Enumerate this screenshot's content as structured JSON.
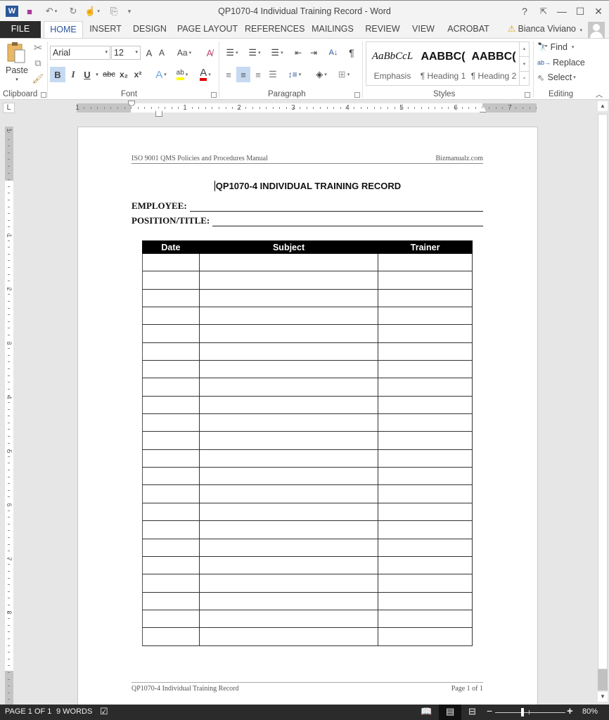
{
  "window": {
    "title": "QP1070-4 Individual Training Record - Word",
    "help_label": "?",
    "ribbon_display_label": "⇱",
    "minimize_label": "—",
    "maximize_label": "☐",
    "close_label": "✕"
  },
  "quick_access": [
    {
      "name": "word-logo-icon",
      "glyph": "W"
    },
    {
      "name": "save-icon",
      "glyph": "💾"
    },
    {
      "name": "undo-icon",
      "glyph": "↶"
    },
    {
      "name": "redo-icon",
      "glyph": "↻"
    },
    {
      "name": "touch-mode-icon",
      "glyph": "☝"
    },
    {
      "name": "customize-qat-icon",
      "glyph": "⎘"
    }
  ],
  "tabs": [
    "FILE",
    "HOME",
    "INSERT",
    "DESIGN",
    "PAGE LAYOUT",
    "REFERENCES",
    "MAILINGS",
    "REVIEW",
    "VIEW",
    "ACROBAT"
  ],
  "active_tab": "HOME",
  "user": {
    "name": "Bianca Viviano",
    "warning_icon": "⚠"
  },
  "ribbon": {
    "clipboard": {
      "paste_label": "Paste",
      "group_label": "Clipboard"
    },
    "font": {
      "font_name": "Arial",
      "font_size": "12",
      "grow_label": "A",
      "shrink_label": "A",
      "change_case_label": "Aa",
      "bold_label": "B",
      "italic_label": "I",
      "underline_label": "U",
      "strike_label": "abc",
      "subscript_label": "x₂",
      "superscript_label": "x²",
      "text_effects_label": "A",
      "highlight_label": "ab",
      "font_color_label": "A",
      "highlight_color": "#ffff00",
      "font_color": "#e00000",
      "group_label": "Font"
    },
    "paragraph": {
      "pilcrow_label": "¶",
      "sort_label": "A↓",
      "group_label": "Paragraph"
    },
    "styles": {
      "items": [
        {
          "sample": "AaBbCcL",
          "name": "Emphasis"
        },
        {
          "sample": "AABBC(",
          "name": "¶ Heading 1"
        },
        {
          "sample": "AABBC(",
          "name": "¶ Heading 2"
        }
      ],
      "group_label": "Styles"
    },
    "editing": {
      "find_label": "Find",
      "replace_label": "Replace",
      "select_label": "Select",
      "group_label": "Editing"
    }
  },
  "ruler": {
    "h_numbers": [
      "1",
      "1",
      "2",
      "3",
      "4",
      "5",
      "6",
      "7"
    ],
    "v_numbers": [
      "1",
      "1",
      "2",
      "3",
      "4",
      "5",
      "6",
      "7",
      "8"
    ],
    "tab_selector": "L"
  },
  "document": {
    "header_left": "ISO 9001 QMS Policies and Procedures Manual",
    "header_right": "Bizmanualz.com",
    "title": "QP1070-4 INDIVIDUAL TRAINING RECORD",
    "fields": [
      {
        "label": "EMPLOYEE:",
        "value": ""
      },
      {
        "label": "POSITION/TITLE:",
        "value": ""
      }
    ],
    "table": {
      "columns": [
        "Date",
        "Subject",
        "Trainer"
      ],
      "row_count": 22,
      "rows": []
    },
    "footer_left": "QP1070-4 Individual Training Record",
    "footer_right": "Page 1 of 1"
  },
  "status": {
    "page": "PAGE 1 OF 1",
    "words": "9 WORDS",
    "zoom_percent": "80%",
    "zoom_level": 80
  }
}
